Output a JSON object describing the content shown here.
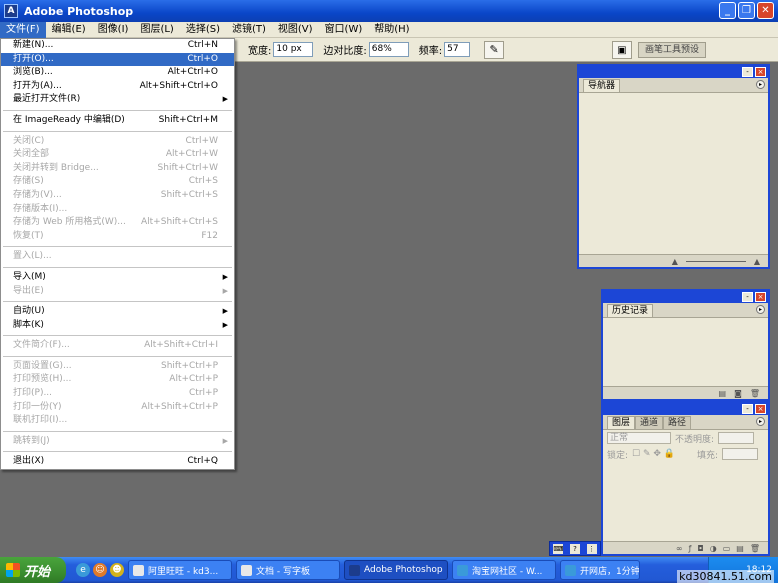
{
  "window": {
    "title": "Adobe Photoshop",
    "icon_letter": "A"
  },
  "menubar": [
    "文件(F)",
    "编辑(E)",
    "图像(I)",
    "图层(L)",
    "选择(S)",
    "滤镜(T)",
    "视图(V)",
    "窗口(W)",
    "帮助(H)"
  ],
  "options": {
    "width_label": "宽度:",
    "width_value": "10 px",
    "contrast_label": "边对比度:",
    "contrast_value": "68%",
    "frequency_label": "频率:",
    "frequency_value": "57",
    "preset_tab": "画笔工具预设"
  },
  "file_menu": {
    "new": {
      "label": "新建(N)...",
      "shortcut": "Ctrl+N"
    },
    "open": {
      "label": "打开(O)...",
      "shortcut": "Ctrl+O"
    },
    "browse": {
      "label": "浏览(B)...",
      "shortcut": "Alt+Ctrl+O"
    },
    "open_as": {
      "label": "打开为(A)...",
      "shortcut": "Alt+Shift+Ctrl+O"
    },
    "recent": {
      "label": "最近打开文件(R)"
    },
    "imageready": {
      "label": "在 ImageReady 中编辑(D)",
      "shortcut": "Shift+Ctrl+M"
    },
    "close": {
      "label": "关闭(C)",
      "shortcut": "Ctrl+W"
    },
    "close_all": {
      "label": "关闭全部",
      "shortcut": "Alt+Ctrl+W"
    },
    "close_bridge": {
      "label": "关闭并转到 Bridge...",
      "shortcut": "Shift+Ctrl+W"
    },
    "save": {
      "label": "存储(S)",
      "shortcut": "Ctrl+S"
    },
    "save_as": {
      "label": "存储为(V)...",
      "shortcut": "Shift+Ctrl+S"
    },
    "save_version": {
      "label": "存储版本(I)..."
    },
    "save_web": {
      "label": "存储为 Web 所用格式(W)...",
      "shortcut": "Alt+Shift+Ctrl+S"
    },
    "revert": {
      "label": "恢复(T)",
      "shortcut": "F12"
    },
    "place": {
      "label": "置入(L)..."
    },
    "import": {
      "label": "导入(M)"
    },
    "export": {
      "label": "导出(E)"
    },
    "automate": {
      "label": "自动(U)"
    },
    "scripts": {
      "label": "脚本(K)"
    },
    "file_info": {
      "label": "文件简介(F)...",
      "shortcut": "Alt+Shift+Ctrl+I"
    },
    "page_setup": {
      "label": "页面设置(G)...",
      "shortcut": "Shift+Ctrl+P"
    },
    "print_preview": {
      "label": "打印预览(H)...",
      "shortcut": "Alt+Ctrl+P"
    },
    "print": {
      "label": "打印(P)...",
      "shortcut": "Ctrl+P"
    },
    "print_one": {
      "label": "打印一份(Y)",
      "shortcut": "Alt+Shift+Ctrl+P"
    },
    "print_online": {
      "label": "联机打印(I)..."
    },
    "jump_to": {
      "label": "跳转到(J)"
    },
    "exit": {
      "label": "退出(X)",
      "shortcut": "Ctrl+Q"
    }
  },
  "panels": {
    "navigator": {
      "tab": "导航器"
    },
    "history": {
      "tab": "历史记录"
    },
    "layers": {
      "tabs": [
        "图层",
        "通道",
        "路径"
      ],
      "blend_mode": "正常",
      "opacity_label": "不透明度:",
      "lock_label": "锁定:",
      "fill_label": "填充:"
    }
  },
  "taskbar": {
    "start_label": "开始",
    "tasks": [
      "阿里旺旺 - kd3...",
      "文档 - 写字板",
      "Adobe Photoshop",
      "淘宝网社区 - W...",
      "开网店，1分钟..."
    ],
    "clock": "18:12"
  },
  "watermark": "kd30841.51.com"
}
